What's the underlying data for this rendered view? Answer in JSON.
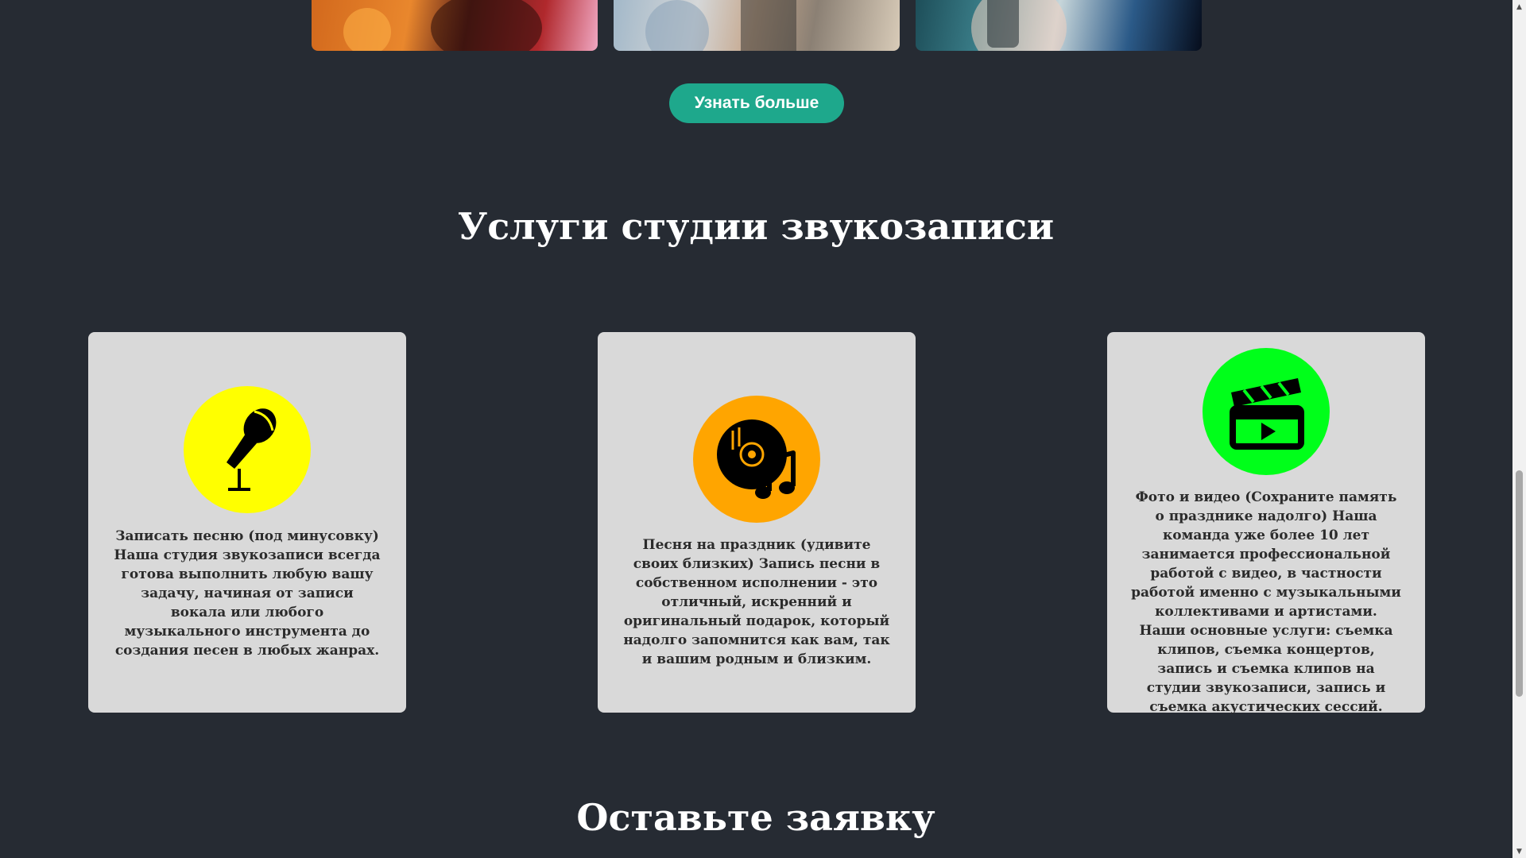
{
  "hero": {
    "button_label": "Узнать больше"
  },
  "services": {
    "title": "Услуги студии звукозаписи",
    "cards": [
      {
        "icon": "microphone-icon",
        "icon_color": "#ffff00",
        "text": "Записать песню (под минусовку) Наша студия звукозаписи всегда готова выполнить любую вашу задачу, начиная от записи вокала или любого музыкального инструмента до создания песен в любых жанрах."
      },
      {
        "icon": "music-disc-icon",
        "icon_color": "#ffa500",
        "text": "Песня на праздник (удивите своих близких) Запись песни в собственном исполнении - это отличный, искренний и оригинальный подарок, который надолго запомнится как вам, так и вашим родным и близким."
      },
      {
        "icon": "video-clapperboard-icon",
        "icon_color": "#00ff1a",
        "text": "Фото и видео (Сохраните память о празднике надолго) Наша команда уже более 10 лет занимается профессиональной работой с видео, в частности работой именно с музыкальными коллективами и артистами. Наши основные услуги: съемка клипов, съемка концертов, запись и съемка клипов на студии звукозаписи, запись и съемка акустических сессий."
      }
    ]
  },
  "request": {
    "title": "Оставьте заявку"
  },
  "colors": {
    "background": "#262b33",
    "accent": "#1ea88c",
    "card": "#d9d9d9"
  }
}
